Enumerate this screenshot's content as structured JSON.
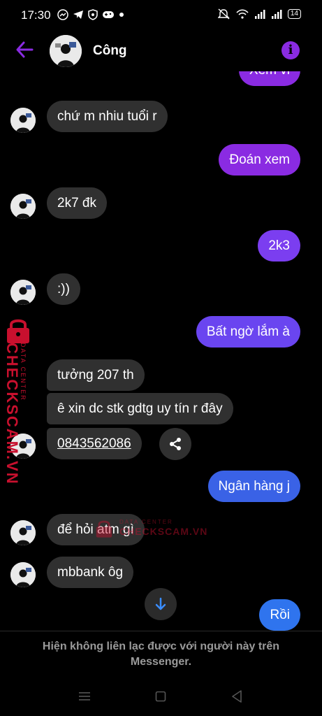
{
  "status_bar": {
    "time": "17:30",
    "left_icons": [
      "messenger-icon",
      "telegram-icon",
      "shield-icon",
      "gamepad-icon",
      "dot-icon"
    ],
    "right_icons": [
      "mute-icon",
      "wifi-icon",
      "signal-icon",
      "signal-icon",
      "battery-icon"
    ],
    "battery": "14"
  },
  "header": {
    "name": "Công",
    "accent_color": "#8a2be2"
  },
  "messages": [
    {
      "side": "out",
      "text": "Xem vi",
      "color": "#8a2be2"
    },
    {
      "side": "in",
      "text": "chứ m nhiu tuổi r"
    },
    {
      "side": "out",
      "text": "Đoán xem",
      "color": "#8a2be2"
    },
    {
      "side": "in",
      "text": "2k7 đk"
    },
    {
      "side": "out",
      "text": "2k3",
      "color": "#7b3ef0"
    },
    {
      "side": "in",
      "text": ":))"
    },
    {
      "side": "out",
      "text": "Bất ngờ lắm à",
      "color": "#6a45f0"
    },
    {
      "side": "in",
      "text": "tưởng 207 th"
    },
    {
      "side": "in",
      "text": "ê xin dc stk gdtg uy tín r đây"
    },
    {
      "side": "in",
      "text": "0843562086",
      "link": true
    },
    {
      "side": "out",
      "text": "Ngân hàng j",
      "color": "#3a62e6"
    },
    {
      "side": "in",
      "text": "để hỏi atm gì"
    },
    {
      "side": "in",
      "text": "mbbank ôg"
    },
    {
      "side": "out",
      "text": "Rồi",
      "color": "#2f74ee"
    }
  ],
  "watermark": {
    "side_big": "CHECKSCAM.VN",
    "side_small": "DATA CENTER",
    "center_small": "DATA CENTER",
    "center_big": "CHECKSCAM.VN"
  },
  "footer": {
    "notice": "Hiện không liên lạc được với người này trên Messenger."
  },
  "navbar": {
    "icons": [
      "menu-icon",
      "home-square-icon",
      "back-triangle-icon"
    ]
  }
}
